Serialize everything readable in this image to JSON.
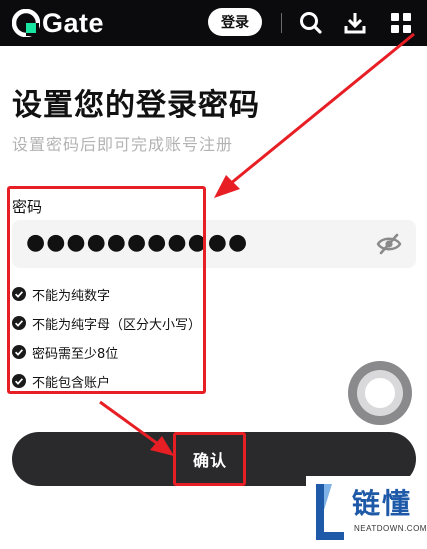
{
  "header": {
    "logo_text": "Gate",
    "login_label": "登录",
    "icons": [
      "search-icon",
      "download-icon",
      "grid-menu-icon"
    ],
    "brand_color": "#0b0b0d"
  },
  "page": {
    "title": "设置您的登录密码",
    "subtitle": "设置密码后即可完成账号注册"
  },
  "password_field": {
    "label": "密码",
    "value": "●●●●●●●●●●●",
    "visibility_icon": "eye-off-icon"
  },
  "rules": [
    {
      "text": "不能为纯数字",
      "met": true
    },
    {
      "text": "不能为纯字母（区分大小写）",
      "met": true
    },
    {
      "text": "密码需至少8位",
      "met": true
    },
    {
      "text": "不能包含账户",
      "met": true
    }
  ],
  "confirm": {
    "label": "确认"
  },
  "annotation_color": "#e81e25",
  "watermark": {
    "title": "链懂",
    "site": "NEATDOWN.COM"
  }
}
